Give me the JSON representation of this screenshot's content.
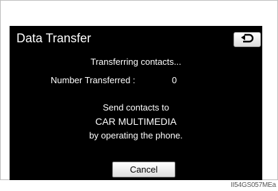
{
  "screen": {
    "title": "Data Transfer",
    "back_icon": "back-arrow-icon",
    "status": "Transferring contacts...",
    "number_label": "Number Transferred :",
    "number_value": "0",
    "instruction_line1": "Send contacts to",
    "instruction_line2": "CAR MULTIMEDIA",
    "instruction_line3": "by operating the phone.",
    "cancel_label": "Cancel"
  },
  "caption": "II54GS057MEa",
  "colors": {
    "screen_background": "#000000",
    "text": "#ffffff",
    "button_face": "#eeeeee"
  }
}
